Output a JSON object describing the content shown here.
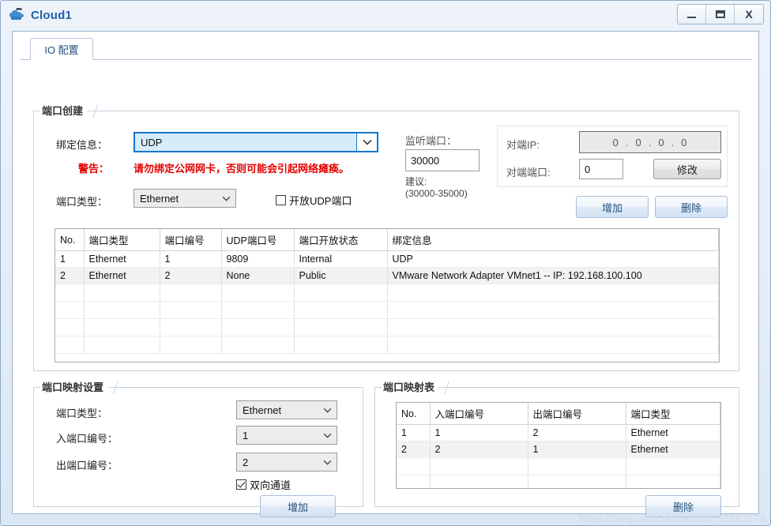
{
  "window": {
    "title": "Cloud1",
    "icon": "cloud-icon",
    "controls": {
      "minimize": "–",
      "maximize": "□",
      "close": "X"
    }
  },
  "tabs": [
    {
      "label": "IO 配置",
      "active": true
    }
  ],
  "port_create": {
    "legend": "端口创建",
    "bind_label": "绑定信息：",
    "bind_value": "UDP",
    "warning_label": "警告：",
    "warning_text": "请勿绑定公网网卡，否则可能会引起网络瘫痪。",
    "port_type_label": "端口类型：",
    "port_type_value": "Ethernet",
    "open_udp_label": "开放UDP端口",
    "open_udp_checked": false,
    "listen_port_label": "监听端口：",
    "listen_port_value": "30000",
    "suggest_label": "建议:",
    "suggest_range": "(30000-35000)",
    "peer_ip_label": "对端IP:",
    "peer_ip_octets": [
      "0",
      "0",
      "0",
      "0"
    ],
    "peer_port_label": "对端端口:",
    "peer_port_value": "0",
    "modify_button": "修改",
    "add_button": "增加",
    "delete_button": "删除"
  },
  "port_table": {
    "columns": [
      "No.",
      "端口类型",
      "端口编号",
      "UDP端口号",
      "端口开放状态",
      "绑定信息"
    ],
    "rows": [
      [
        "1",
        "Ethernet",
        "1",
        "9809",
        "Internal",
        "UDP"
      ],
      [
        "2",
        "Ethernet",
        "2",
        "None",
        "Public",
        "VMware Network Adapter VMnet1 -- IP: 192.168.100.100"
      ]
    ],
    "empty_rows": 4
  },
  "mapping_settings": {
    "legend": "端口映射设置",
    "port_type_label": "端口类型：",
    "port_type_value": "Ethernet",
    "in_port_label": "入端口编号：",
    "in_port_value": "1",
    "out_port_label": "出端口编号：",
    "out_port_value": "2",
    "bidirectional_label": "双向通道",
    "bidirectional_checked": true,
    "add_button": "增加"
  },
  "mapping_table": {
    "legend": "端口映射表",
    "columns": [
      "No.",
      "入端口编号",
      "出端口编号",
      "端口类型"
    ],
    "rows": [
      [
        "1",
        "1",
        "2",
        "Ethernet"
      ],
      [
        "2",
        "2",
        "1",
        "Ethernet"
      ]
    ],
    "empty_rows": 3,
    "delete_button": "删除"
  },
  "watermark": "https://blog.csdn.net/weixin_53567573",
  "colors": {
    "accent": "#1f5fa8",
    "warning": "#e40000",
    "combo_focus": "#1677c9",
    "button_blue_text": "#24527d"
  }
}
